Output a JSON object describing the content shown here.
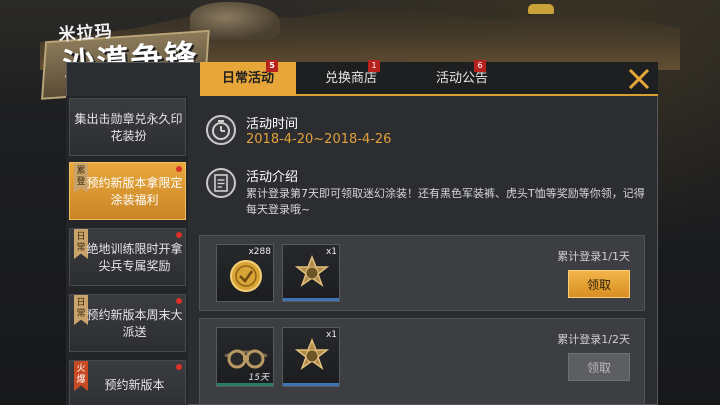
{
  "logo": {
    "line1": "米拉玛",
    "line2": "沙漠争锋"
  },
  "tabs": [
    {
      "label": "日常活动",
      "badge": "5",
      "active": true
    },
    {
      "label": "兑换商店",
      "badge": "1",
      "active": false
    },
    {
      "label": "活动公告",
      "badge": "6",
      "active": false
    }
  ],
  "sidebar": {
    "items": [
      {
        "label": "集出击勋章兑永久印花装扮",
        "ribbon": "",
        "dot": false,
        "active": false
      },
      {
        "label": "预约新版本拿限定涂装福利",
        "ribbon": "累登",
        "dot": true,
        "active": true
      },
      {
        "label": "绝地训练限时开拿尖兵专属奖励",
        "ribbon": "日常",
        "dot": true,
        "active": false
      },
      {
        "label": "预约新版本周末大派送",
        "ribbon": "日常",
        "dot": true,
        "active": false
      },
      {
        "label": "预约新版本",
        "ribbon": "火爆",
        "dot": true,
        "active": false
      }
    ]
  },
  "event": {
    "time_title": "活动时间",
    "time_value": "2018-4-20~2018-4-26",
    "intro_title": "活动介绍",
    "intro_text": "累计登录第7天即可领取迷幻涂装！还有黑色军装裤、虎头T恤等奖励等你领，记得每天登录哦~"
  },
  "rewards": [
    {
      "items": [
        {
          "icon": "gold-coin-icon",
          "count": "x288",
          "duration": ""
        },
        {
          "icon": "medal-badge-icon",
          "count": "x1",
          "duration": ""
        }
      ],
      "progress": "累计登录1/1天",
      "button": "领取",
      "enabled": true
    },
    {
      "items": [
        {
          "icon": "goggles-icon",
          "count": "",
          "duration": "15天"
        },
        {
          "icon": "medal-badge-icon",
          "count": "x1",
          "duration": ""
        }
      ],
      "progress": "累计登录1/2天",
      "button": "领取",
      "enabled": false
    }
  ],
  "colors": {
    "accent": "#e6a63a",
    "badge": "#b8221c",
    "date": "#e2a03a"
  }
}
